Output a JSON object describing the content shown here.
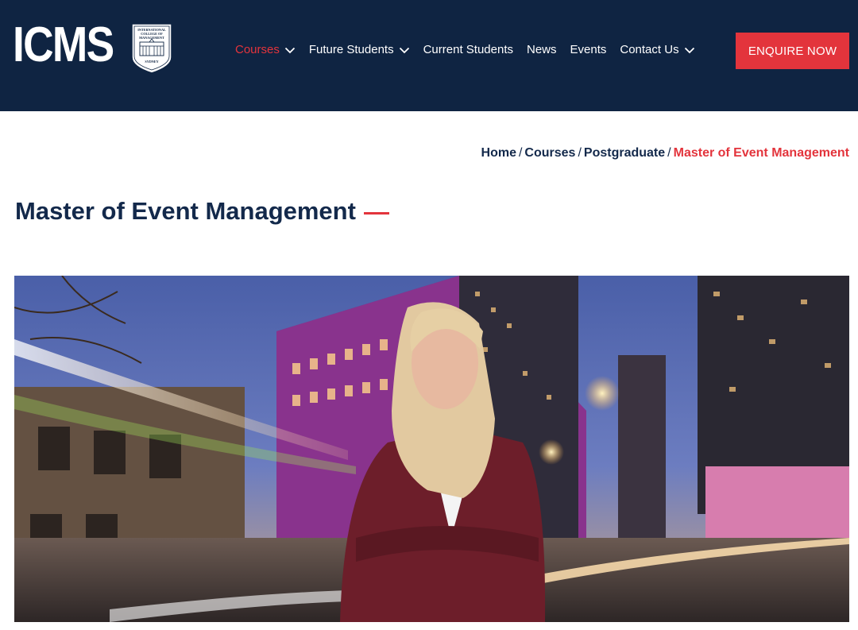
{
  "header": {
    "logo_text": "ICMS",
    "crest_lines": [
      "INTERNATIONAL",
      "COLLEGE OF",
      "MANAGEMENT",
      "SYDNEY"
    ],
    "nav": [
      {
        "label": "Courses",
        "has_dropdown": true,
        "active": true
      },
      {
        "label": "Future Students",
        "has_dropdown": true,
        "active": false
      },
      {
        "label": "Current Students",
        "has_dropdown": false,
        "active": false
      },
      {
        "label": "News",
        "has_dropdown": false,
        "active": false
      },
      {
        "label": "Events",
        "has_dropdown": false,
        "active": false
      },
      {
        "label": "Contact Us",
        "has_dropdown": true,
        "active": false
      }
    ],
    "cta_label": "ENQUIRE NOW"
  },
  "breadcrumb": {
    "items": [
      "Home",
      "Courses",
      "Postgraduate"
    ],
    "separator": "/",
    "current": "Master of Event Management"
  },
  "page": {
    "title": "Master of Event Management"
  },
  "hero": {
    "alt_subject": "Woman in burgundy blazer with arms crossed in front of illuminated Sydney city street at dusk"
  },
  "colors": {
    "header_bg": "#0f2442",
    "accent": "#e3343c",
    "title_text": "#13294b"
  }
}
